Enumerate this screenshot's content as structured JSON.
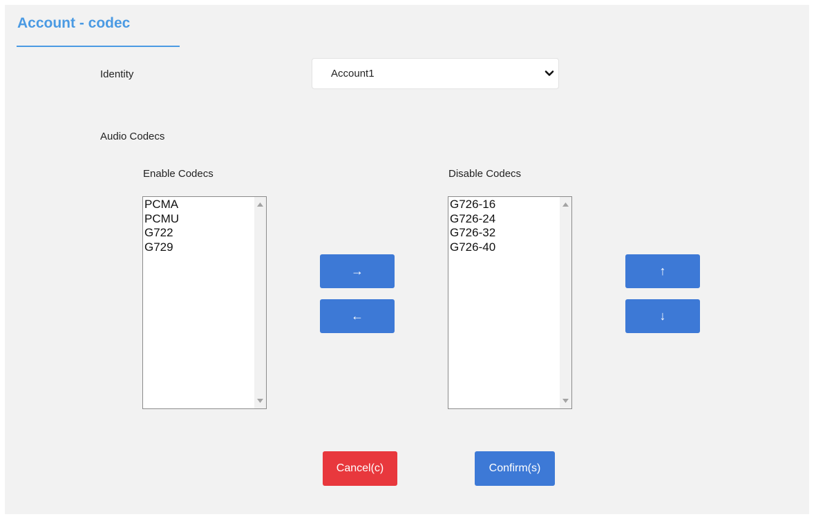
{
  "header": {
    "title": "Account - codec"
  },
  "identity": {
    "label": "Identity",
    "selected": "Account1"
  },
  "audio": {
    "section_label": "Audio Codecs",
    "enable": {
      "label": "Enable Codecs",
      "items": [
        "PCMA",
        "PCMU",
        "G722",
        "G729"
      ]
    },
    "disable": {
      "label": "Disable Codecs",
      "items": [
        "G726-16",
        "G726-24",
        "G726-32",
        "G726-40"
      ]
    }
  },
  "transfer": {
    "move_right": "→",
    "move_left": "←"
  },
  "order": {
    "move_up": "↑",
    "move_down": "↓"
  },
  "actions": {
    "cancel": "Cancel(c)",
    "confirm": "Confirm(s)"
  },
  "colors": {
    "accent": "#4a9ae3",
    "primary_button": "#3d79d6",
    "cancel_button": "#e8383d",
    "panel_bg": "#f2f2f2"
  }
}
